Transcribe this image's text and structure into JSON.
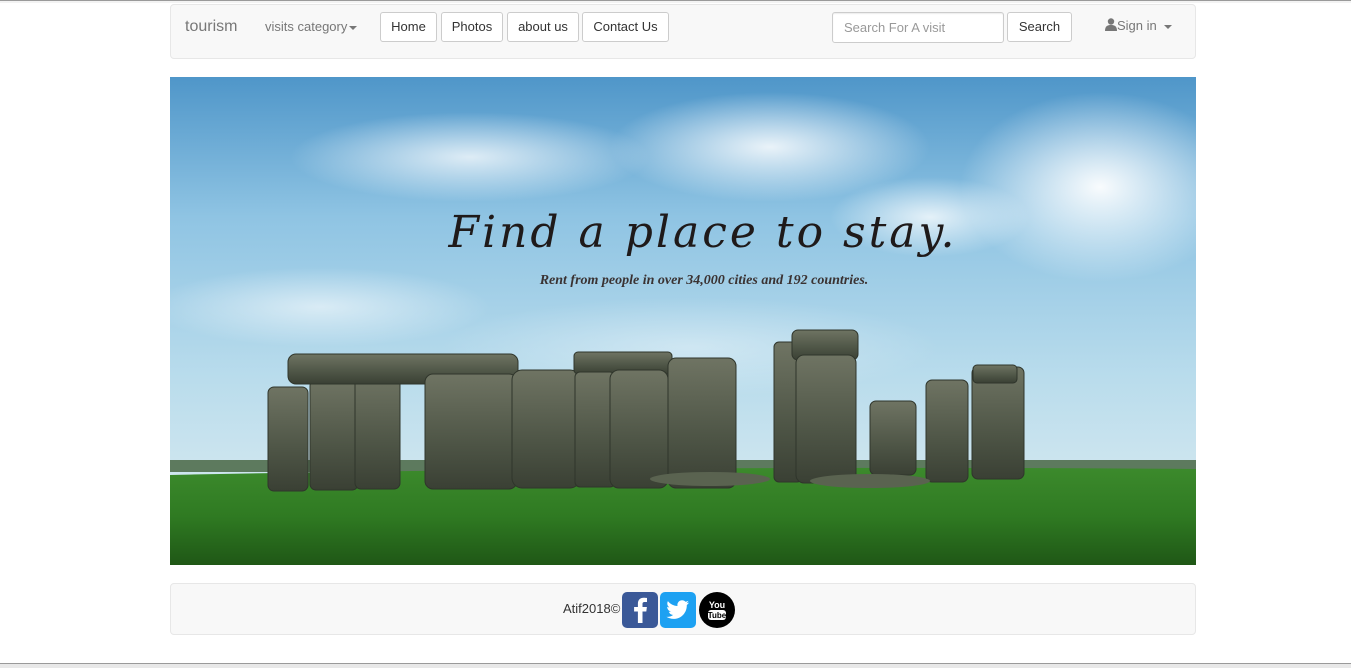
{
  "navbar": {
    "brand": "tourism",
    "category_dropdown": "visits category",
    "buttons": {
      "home": "Home",
      "photos": "Photos",
      "about": "about us",
      "contact": "Contact Us"
    },
    "search": {
      "placeholder": "Search For A visit",
      "button": "Search"
    },
    "signin": "Sign in"
  },
  "hero": {
    "title": "Find a place to stay.",
    "subtitle": "Rent from people in over 34,000 cities and 192 countries."
  },
  "footer": {
    "copyright": "Atif2018©",
    "social": [
      "facebook-icon",
      "twitter-icon",
      "youtube-icon"
    ],
    "youtube_text": [
      "You",
      "Tube"
    ]
  },
  "colors": {
    "facebook": "#3b5998",
    "twitter": "#1da1f2",
    "youtube": "#000000",
    "navbar_bg": "#f8f8f8"
  }
}
